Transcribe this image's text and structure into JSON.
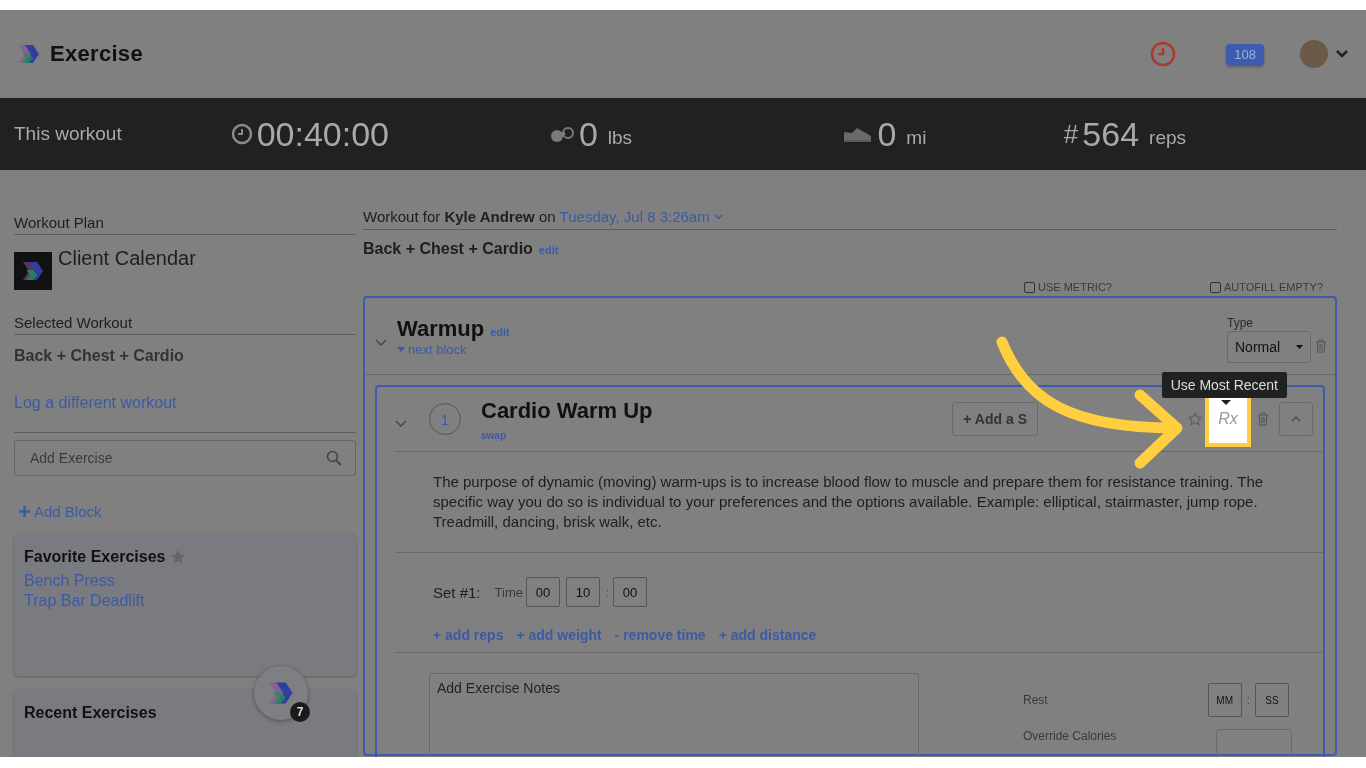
{
  "header": {
    "app_title": "Exercise",
    "notification_count": "108"
  },
  "stats": {
    "label": "This workout",
    "items": [
      {
        "kind": "time",
        "value": "00:40:00"
      },
      {
        "kind": "weight",
        "value": "0",
        "unit": "lbs"
      },
      {
        "kind": "distance",
        "value": "0",
        "unit": "mi"
      },
      {
        "kind": "reps",
        "symbol": "#",
        "value": "564",
        "unit": "reps"
      }
    ]
  },
  "sidebar": {
    "plan_heading": "Workout Plan",
    "plan_name": "Client Calendar",
    "selected_heading": "Selected Workout",
    "selected_workout": "Back + Chest + Cardio",
    "change_link": "Log a different workout",
    "search": {
      "placeholder": "Add Exercise"
    },
    "add_block": "Add Block",
    "favorites": {
      "title": "Favorite Exercises",
      "items": [
        "Bench Press",
        "Trap Bar Deadlift"
      ]
    },
    "recent": {
      "title": "Recent Exercises"
    },
    "floating_badge": "7"
  },
  "workout": {
    "heading": "Workout for **Kyle Andrew** on",
    "date": "Tuesday, Jul 8 3:26am",
    "name": "Back + Chest + Cardio",
    "edit_link": "edit",
    "options": [
      {
        "label": "USE METRIC?",
        "checked": false
      },
      {
        "label": "AUTOFILL EMPTY?",
        "checked": false
      }
    ],
    "block": {
      "title": "Warmup",
      "edit_link": "edit",
      "next_link": "next block",
      "type_label": "Type",
      "type_value": "Normal",
      "exercise": {
        "number": "1",
        "title": "Cardio Warm Up",
        "swap_link": "swap",
        "add_set": "+ Add a S",
        "favorite": false,
        "rx_button": "Rx",
        "tooltip": "Use Most Recent",
        "description": "The purpose of dynamic (moving) warm-ups is to increase blood flow to muscle and prepare them for resistance training. The specific way you do so is individual to your preferences and the options available. Example: elliptical, stairmaster, jump rope. Treadmill, dancing, brisk walk, etc.",
        "sets": [
          {
            "label": "Set #1:",
            "time_label": "Time",
            "hours": "00",
            "minutes": "10",
            "separator": ":",
            "seconds": "00"
          }
        ],
        "actions": [
          "+ add reps",
          "+ add weight",
          "- remove time",
          "+ add distance"
        ],
        "notes_placeholder": "Add Exercise Notes",
        "rest_label": "Rest",
        "rest_minutes": "MM",
        "rest_separator": ":",
        "rest_seconds": "SS",
        "calories_label": "Override Calories"
      }
    }
  }
}
